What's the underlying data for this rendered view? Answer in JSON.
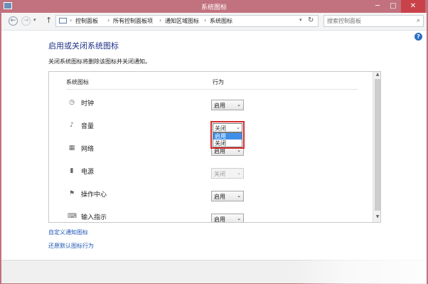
{
  "window": {
    "title": "系统图标",
    "minimize": "─",
    "maximize": "□",
    "close": "✕"
  },
  "nav": {
    "back": "←",
    "forward": "→",
    "history_dropdown": "▾",
    "up": "↑",
    "refresh": "↻",
    "address_dropdown": "▾",
    "breadcrumb": [
      "控制面板",
      "所有控制面板项",
      "通知区域图标",
      "系统图标"
    ],
    "separator": "›",
    "search_placeholder": "搜索控制面板",
    "search_icon": "⌕"
  },
  "help": "?",
  "page": {
    "title": "启用或关闭系统图标",
    "description": "关闭系统图标将删除该图标并关闭通知。"
  },
  "table": {
    "headers": {
      "icon": "系统图标",
      "behavior": "行为"
    },
    "rows": [
      {
        "icon": "clock-icon",
        "glyph": "◷",
        "label": "时钟",
        "value": "启用",
        "disabled": false
      },
      {
        "icon": "volume-icon",
        "glyph": "♪",
        "label": "音量",
        "value": "关闭",
        "disabled": false,
        "open": true
      },
      {
        "icon": "network-icon",
        "glyph": "▦",
        "label": "网络",
        "value": "启用",
        "disabled": false
      },
      {
        "icon": "power-icon",
        "glyph": "▮",
        "label": "电源",
        "value": "关闭",
        "disabled": true
      },
      {
        "icon": "action-center-icon",
        "glyph": "⚑",
        "label": "操作中心",
        "value": "启用",
        "disabled": false
      },
      {
        "icon": "input-indicator-icon",
        "glyph": "⌨",
        "label": "输入指示",
        "value": "启用",
        "disabled": false
      }
    ]
  },
  "dropdown": {
    "current": "关闭",
    "options": [
      "启用",
      "关闭"
    ],
    "highlighted": "启用"
  },
  "links": {
    "customize": "自定义通知图标",
    "restore": "还原默认图标行为"
  },
  "colors": {
    "title_bar": "#c1727e",
    "heading": "#1e3287",
    "link": "#1f57b5",
    "highlight_border": "#d62f2f",
    "selection": "#3f8fe8"
  }
}
